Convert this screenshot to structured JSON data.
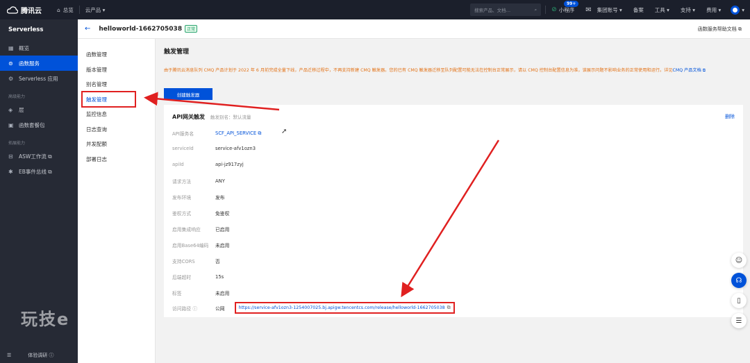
{
  "topbar": {
    "brand": "腾讯云",
    "home": "总览",
    "products": "云产品 ▾",
    "search_placeholder": "搜索产品、文档…",
    "miniapp": "小程序",
    "messages_badge": "99+",
    "account": "集团账号 ▾",
    "filing": "备案",
    "tools": "工具 ▾",
    "support": "支持 ▾",
    "cost": "费用 ▾"
  },
  "sidebar": {
    "title": "Serverless",
    "items": [
      {
        "label": "概览",
        "icon": "grid-icon"
      },
      {
        "label": "函数服务",
        "icon": "function-icon"
      },
      {
        "label": "Serverless 应用",
        "icon": "gear-icon"
      }
    ],
    "section_advanced": "高级能力",
    "advanced_items": [
      {
        "label": "层",
        "icon": "layers-icon"
      },
      {
        "label": "函数套餐包",
        "icon": "package-icon"
      }
    ],
    "section_extend": "拓展能力",
    "extend_items": [
      {
        "label": "ASW工作流 ⧉",
        "icon": "workflow-icon"
      },
      {
        "label": "EB事件总线 ⧉",
        "icon": "eventbus-icon"
      }
    ],
    "bottom_label": "体验调研 ⓘ",
    "watermark": "玩技e"
  },
  "header": {
    "function_name": "helloworld-1662705038",
    "status": "正常",
    "help_link": "函数服务帮助文档 ⧉"
  },
  "nav2": {
    "items": [
      "函数管理",
      "版本管理",
      "别名管理",
      "触发管理",
      "监控信息",
      "日志查询",
      "并发配额",
      "部署日志"
    ]
  },
  "main": {
    "title": "触发管理",
    "notice": "由于腾讯云消息队列 CMQ 产品计划于 2022 年 6 月前完成全量下线，产品迁移过程中，不再支持新建 CMQ 触发器。您的已有 CMQ 触发器迁移至队列配置可能无法在控制台正常展示，请以 CMQ 控制台配置信息为准，该展示问题不影响业务的正常使用和运行。详见",
    "notice_link": "CMQ 产品文档 ⧉",
    "create_button": "创建触发器"
  },
  "trigger": {
    "title": "API网关触发",
    "subtitle": "触发别名：默认流量",
    "delete": "删除",
    "rows": [
      {
        "key": "API服务名",
        "value": "SCF_API_SERVICE ⧉"
      },
      {
        "key": "serviceId",
        "value": "service-afv1ozn3"
      },
      {
        "key": "apiId",
        "value": "api-jz917zyj"
      },
      {
        "key": "请求方法",
        "value": "ANY"
      },
      {
        "key": "发布环境",
        "value": "发布"
      },
      {
        "key": "鉴权方式",
        "value": "免鉴权"
      },
      {
        "key": "启用集成响应",
        "value": "已启用"
      },
      {
        "key": "启用Base64编码",
        "value": "未启用"
      },
      {
        "key": "支持CORS",
        "value": "否"
      },
      {
        "key": "后端超时",
        "value": "15s"
      },
      {
        "key": "标签",
        "value": "未启用"
      },
      {
        "key": "访问路径 ⓘ",
        "value": "公网"
      }
    ],
    "access_url": "https://service-afv1ozn3-1254007025.bj.apigw.tencentcs.com/release/helloworld-1662705038"
  },
  "colors": {
    "primary": "#0052d9",
    "annotation_red": "#e02020",
    "warning": "#e37318",
    "success": "#2ba471"
  }
}
